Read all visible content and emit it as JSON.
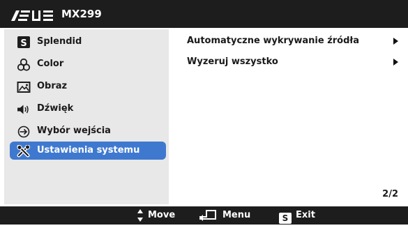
{
  "header": {
    "brand": "ASUS",
    "model": "MX299"
  },
  "sidebar": {
    "items": [
      {
        "label": "Splendid",
        "icon": "splendid-s-icon"
      },
      {
        "label": "Color",
        "icon": "color-circles-icon"
      },
      {
        "label": "Obraz",
        "icon": "image-icon"
      },
      {
        "label": "Dźwięk",
        "icon": "speaker-icon"
      },
      {
        "label": "Wybór wejścia",
        "icon": "input-select-icon"
      },
      {
        "label": "Ustawienia systemu",
        "icon": "tools-icon",
        "selected": true
      }
    ]
  },
  "content": {
    "items": [
      {
        "label": "Automatyczne wykrywanie źródła"
      },
      {
        "label": "Wyzeruj wszystko"
      }
    ],
    "page": "2/2"
  },
  "footer": {
    "move_label": "Move",
    "menu_label": "Menu",
    "exit_label": "Exit",
    "exit_key": "S"
  },
  "colors": {
    "header_bg": "#1d1d1d",
    "sidebar_bg": "#e8e8e8",
    "selected_bg": "#3f79cf",
    "content_bg": "#ffffff"
  }
}
